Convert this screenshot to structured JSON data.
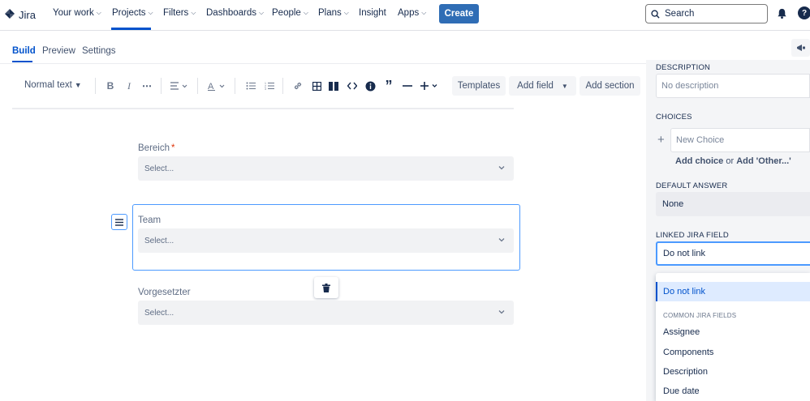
{
  "nav": {
    "logo_text": "Jira",
    "items": [
      {
        "label": "Your work",
        "has_chevron": true
      },
      {
        "label": "Projects",
        "has_chevron": true
      },
      {
        "label": "Filters",
        "has_chevron": true
      },
      {
        "label": "Dashboards",
        "has_chevron": true
      },
      {
        "label": "People",
        "has_chevron": true
      },
      {
        "label": "Plans",
        "has_chevron": true
      },
      {
        "label": "Insight",
        "has_chevron": false
      },
      {
        "label": "Apps",
        "has_chevron": true
      }
    ],
    "active_item": "Projects",
    "create_label": "Create",
    "search_placeholder": "Search",
    "accent_color": "#0052cc",
    "create_color": "#2f6db5"
  },
  "tabs": [
    {
      "label": "Build",
      "active": true
    },
    {
      "label": "Preview",
      "active": false
    },
    {
      "label": "Settings",
      "active": false
    }
  ],
  "toolbar": {
    "text_style": "Normal text",
    "templates_label": "Templates",
    "add_field_label": "Add field",
    "add_section_label": "Add section"
  },
  "form": {
    "fields": [
      {
        "label": "Bereich",
        "required": true,
        "placeholder": "Select..."
      },
      {
        "label": "Team",
        "required": false,
        "placeholder": "Select...",
        "selected": true
      },
      {
        "label": "Vorgesetzter",
        "required": false,
        "placeholder": "Select..."
      }
    ],
    "required_marker": "*"
  },
  "panel": {
    "description_label": "DESCRIPTION",
    "description_placeholder": "No description",
    "choices_label": "CHOICES",
    "new_choice_placeholder": "New Choice",
    "add_choice_label": "Add choice",
    "or_text": "or",
    "add_other_label": "Add 'Other...'",
    "default_answer_label": "DEFAULT ANSWER",
    "default_answer_value": "None",
    "linked_field_label": "LINKED JIRA FIELD",
    "linked_field_value": "Do not link"
  },
  "dropdown": {
    "selected_option": "Do not link",
    "group_label": "COMMON JIRA FIELDS",
    "options": [
      "Assignee",
      "Components",
      "Description",
      "Due date"
    ]
  }
}
